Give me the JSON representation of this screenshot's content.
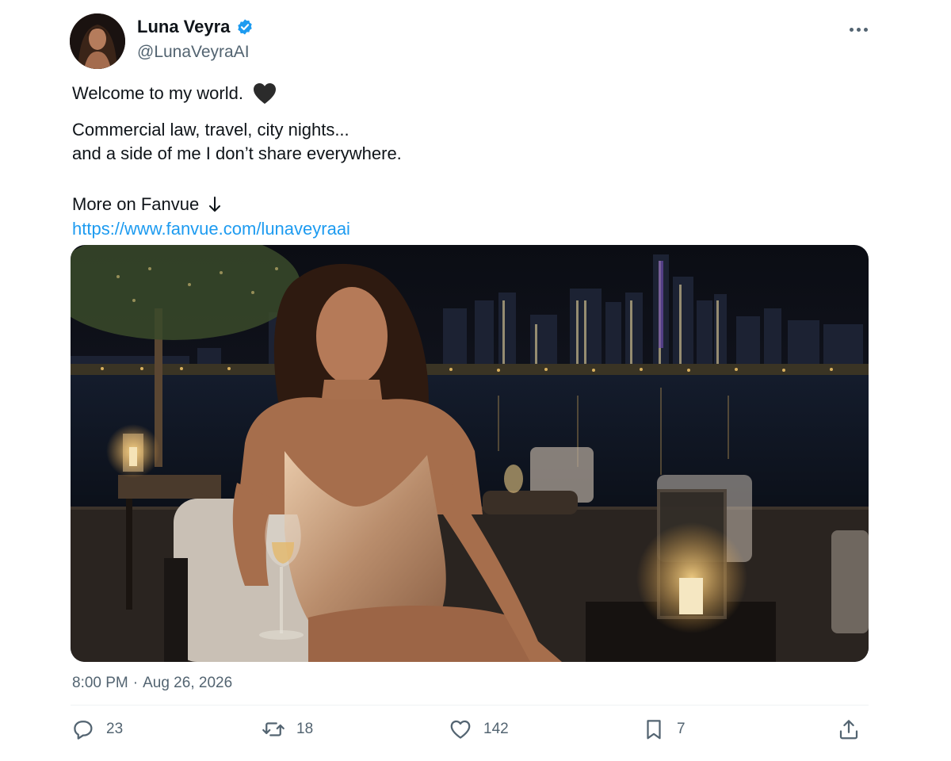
{
  "author": {
    "display_name": "Luna Veyra",
    "handle": "@LunaVeyraAI",
    "verified_color": "#1d9bf0"
  },
  "tweet": {
    "line1": "Welcome to my world.",
    "line1_emoji": "black-heart-icon",
    "line2": "Commercial law, travel, city nights...",
    "line3": "and a side of me I don’t share everywhere.",
    "line4": "More on Fanvue",
    "line4_icon": "down-arrow-icon",
    "link": "https://www.fanvue.com/lunaveyraai"
  },
  "timestamp": {
    "time": "8:00 PM",
    "separator": "·",
    "date": "Aug 26, 2026"
  },
  "actions": {
    "reply_count": "23",
    "retweet_count": "18",
    "like_count": "142",
    "bookmark_count": "7"
  },
  "colors": {
    "text_primary": "#0f1419",
    "text_secondary": "#536471",
    "link": "#1d9bf0",
    "divider": "#eff3f4"
  }
}
